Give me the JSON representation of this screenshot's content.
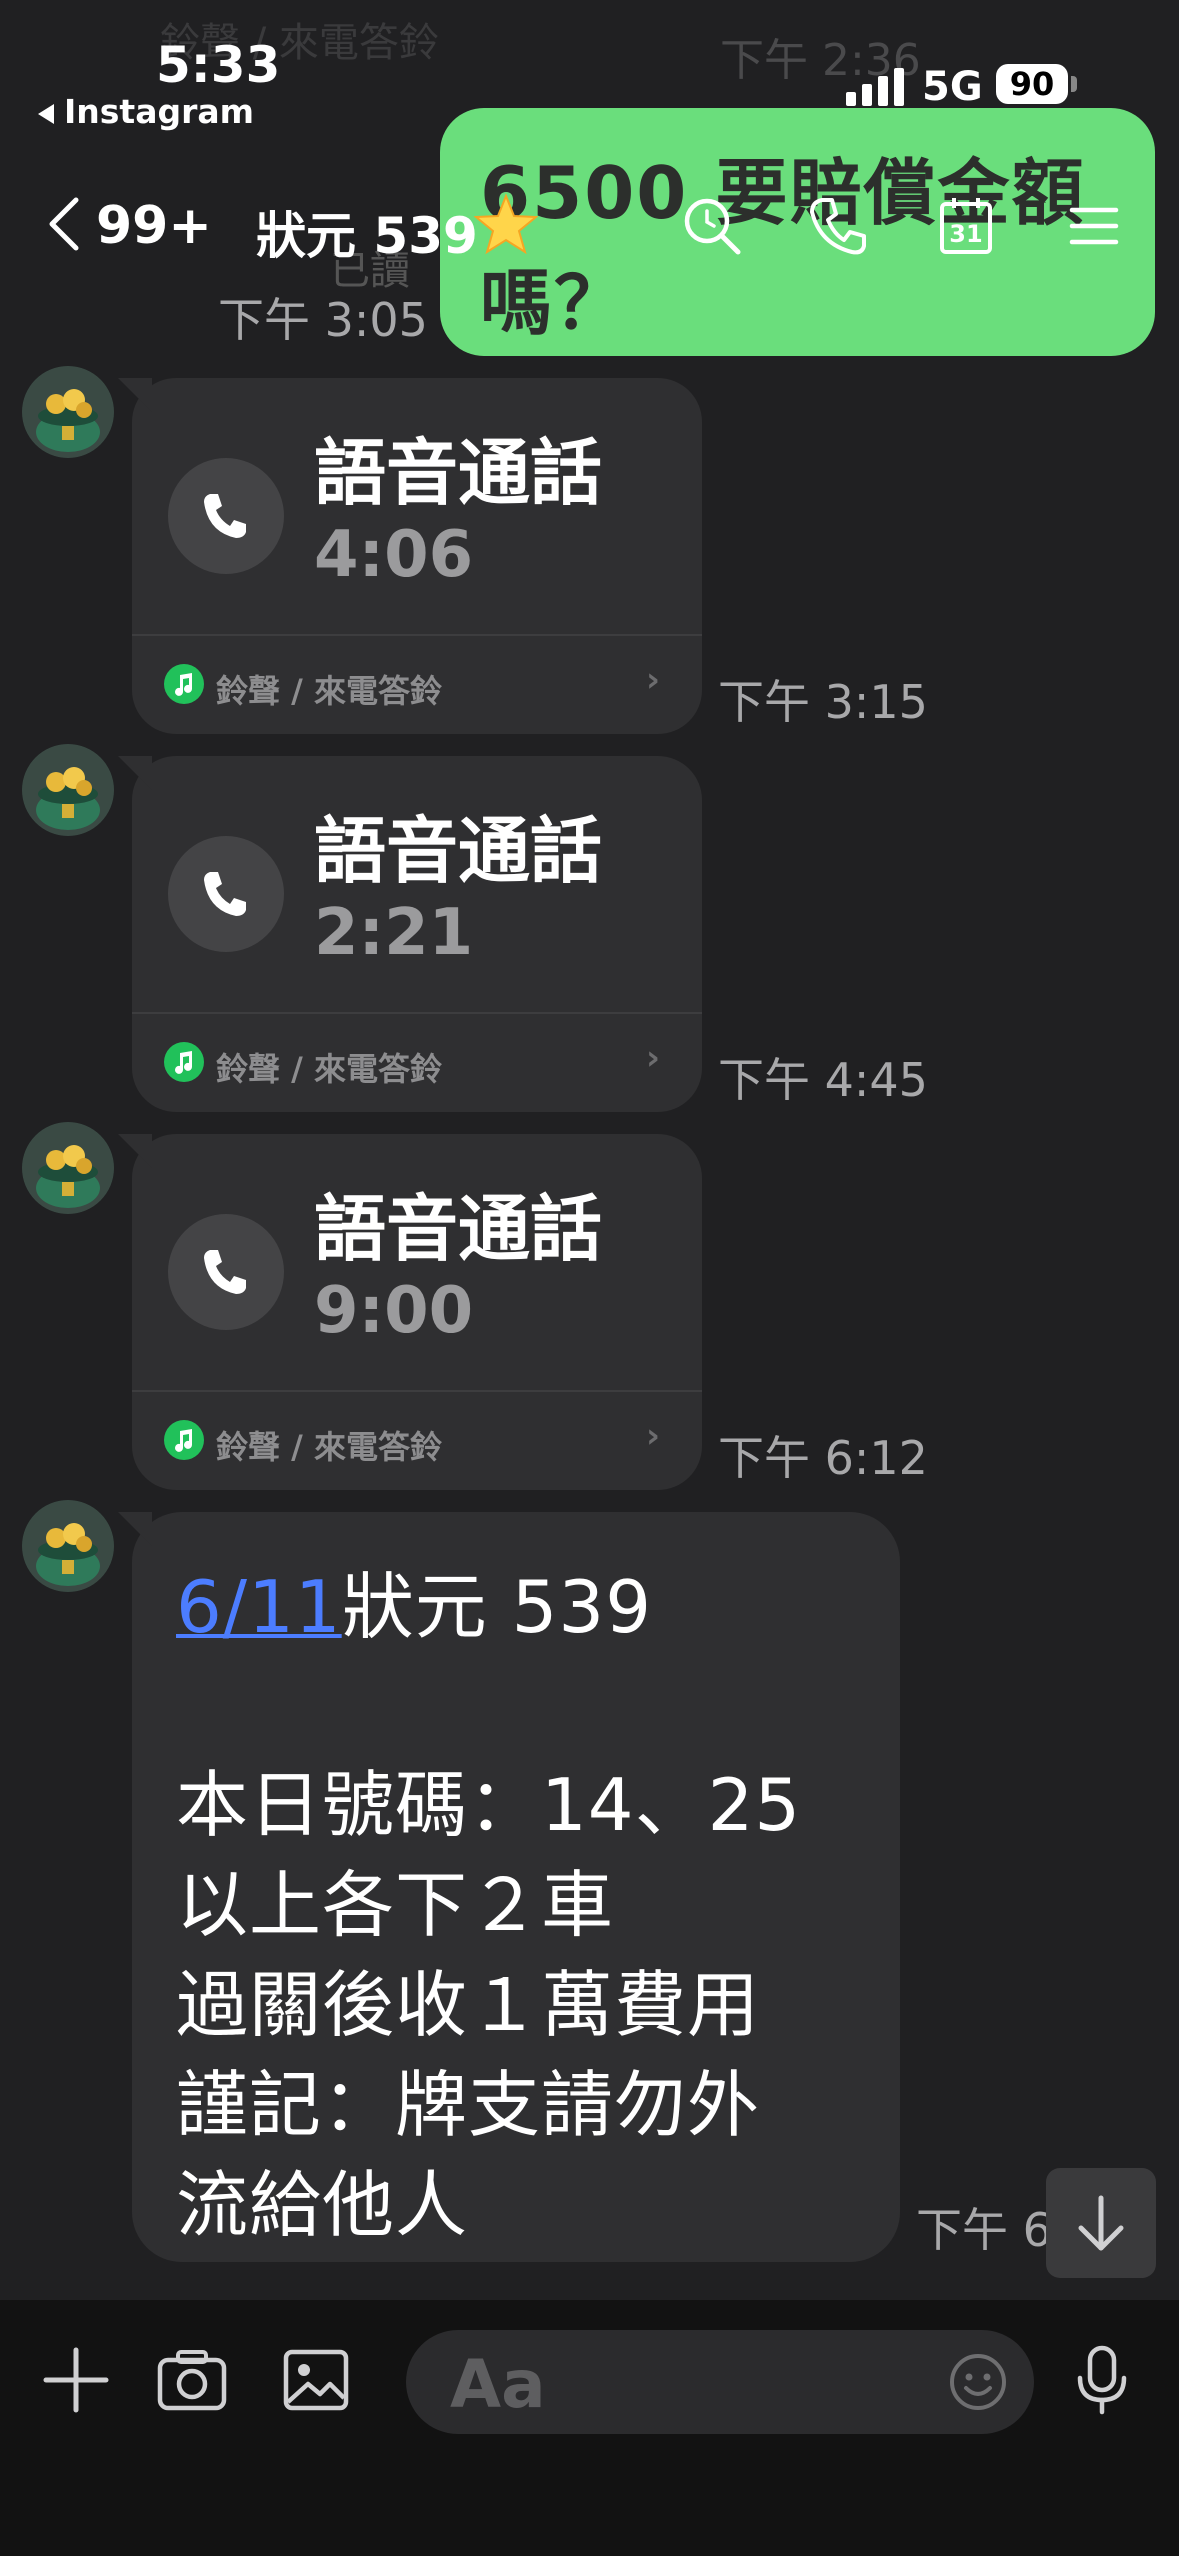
{
  "status_bar": {
    "time": "5:33",
    "back_app": "Instagram",
    "network": "5G",
    "battery": "90"
  },
  "ghost": {
    "prev_label": "鈴聲 / 來電答鈴",
    "prev_time": "下午 2:36",
    "sent_text": "6500 要賠償金額嗎？",
    "read_label": "已讀",
    "sent_time": "下午 3:05"
  },
  "header": {
    "unread_count": "99+",
    "title": "狀元 539",
    "icons": [
      "search-icon",
      "phone-icon",
      "calendar-icon",
      "menu-icon"
    ],
    "calendar_day": "31"
  },
  "calls": [
    {
      "title": "語音通話",
      "duration": "4:06",
      "ringtone_label": "鈴聲 / 來電答鈴",
      "time": "下午 3:15"
    },
    {
      "title": "語音通話",
      "duration": "2:21",
      "ringtone_label": "鈴聲 / 來電答鈴",
      "time": "下午 4:45"
    },
    {
      "title": "語音通話",
      "duration": "9:00",
      "ringtone_label": "鈴聲 / 來電答鈴",
      "time": "下午 6:12"
    }
  ],
  "text_message": {
    "date_link": "6/11",
    "title_rest": "狀元 539",
    "lines": [
      "本日號碼：14、25",
      "以上各下２車",
      "過關後收１萬費用",
      "謹記：牌支請勿外",
      "流給他人"
    ],
    "time": "下午 6"
  },
  "input": {
    "placeholder": "Aa"
  },
  "colors": {
    "background": "#202022",
    "bubble_received": "#2f2f31",
    "bubble_sent": "#6ade7c",
    "link": "#4c7dff",
    "ringtone_green": "#21c15a"
  }
}
